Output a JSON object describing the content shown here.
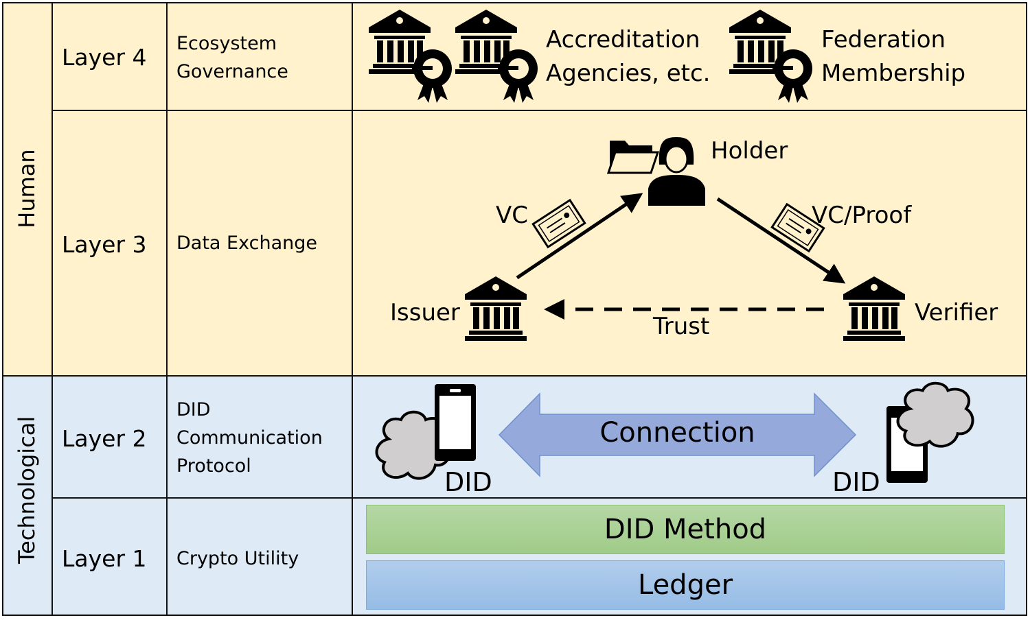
{
  "groups": {
    "human": "Human",
    "technological": "Technological"
  },
  "layers": [
    {
      "label": "Layer 4",
      "name": "Ecosystem Governance",
      "name_lines": [
        "Ecosystem",
        "Governance"
      ]
    },
    {
      "label": "Layer 3",
      "name": "Data Exchange"
    },
    {
      "label": "Layer 2",
      "name": "DID Communication Protocol",
      "name_lines": [
        "DID",
        "Communication",
        "Protocol"
      ]
    },
    {
      "label": "Layer 1",
      "name": "Crypto Utility"
    }
  ],
  "layer4": {
    "accreditation": [
      "Accreditation",
      "Agencies, etc."
    ],
    "federation": [
      "Federation",
      "Membership"
    ]
  },
  "layer3": {
    "holder": "Holder",
    "issuer": "Issuer",
    "verifier": "Verifier",
    "vc": "VC",
    "vc_proof": "VC/Proof",
    "trust": "Trust"
  },
  "layer2": {
    "connection": "Connection",
    "did_left": "DID",
    "did_right": "DID"
  },
  "layer1": {
    "did_method": "DID Method",
    "ledger": "Ledger"
  },
  "colors": {
    "human_bg": "#FFF2CC",
    "tech_bg": "#DEEBF7",
    "connection_arrow": "#8FAADC",
    "did_method": "#A9D18E",
    "ledger": "#9DC3E6",
    "cloud": "#D0CECE"
  }
}
